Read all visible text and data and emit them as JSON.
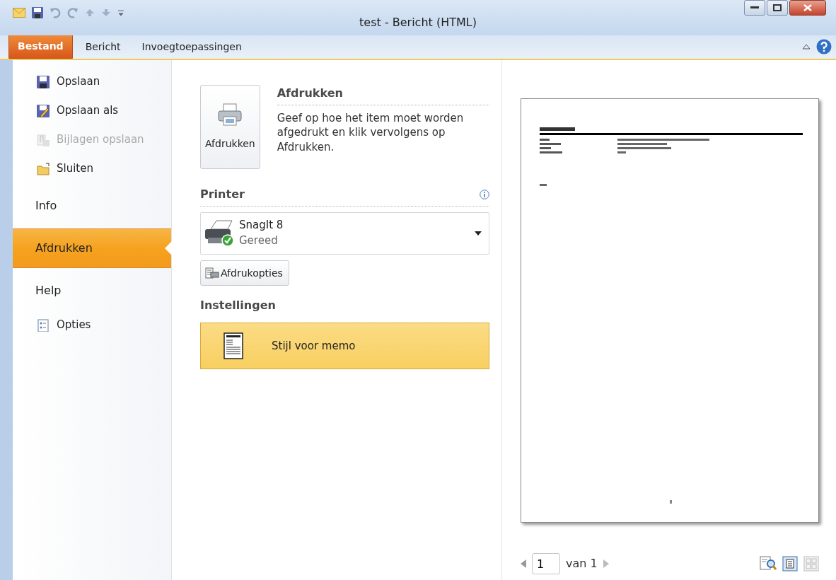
{
  "window": {
    "title": "test - Bericht (HTML)"
  },
  "ribbon_tabs": [
    {
      "label": "Bestand",
      "selected": true
    },
    {
      "label": "Bericht",
      "selected": false
    },
    {
      "label": "Invoegtoepassingen",
      "selected": false
    }
  ],
  "backstage_nav": [
    {
      "label": "Opslaan",
      "kind": "command",
      "disabled": false,
      "selected": false
    },
    {
      "label": "Opslaan als",
      "kind": "command",
      "disabled": false,
      "selected": false
    },
    {
      "label": "Bijlagen opslaan",
      "kind": "command",
      "disabled": true,
      "selected": false
    },
    {
      "label": "Sluiten",
      "kind": "command",
      "disabled": false,
      "selected": false
    },
    {
      "label": "Info",
      "kind": "tab",
      "disabled": false,
      "selected": false
    },
    {
      "label": "Afdrukken",
      "kind": "tab",
      "disabled": false,
      "selected": true
    },
    {
      "label": "Help",
      "kind": "tab",
      "disabled": false,
      "selected": false
    },
    {
      "label": "Opties",
      "kind": "command",
      "disabled": false,
      "selected": false
    }
  ],
  "print": {
    "heading": "Afdrukken",
    "button": "Afdrukken",
    "description": "Geef op hoe het item moet worden afgedrukt en klik vervolgens op Afdrukken.",
    "printer_heading": "Printer",
    "printer": {
      "name": "SnagIt 8",
      "status": "Gereed"
    },
    "options_button": "Afdrukopties",
    "settings_heading": "Instellingen",
    "style": "Stijl voor memo"
  },
  "pager": {
    "page": "1",
    "of": "van 1"
  }
}
